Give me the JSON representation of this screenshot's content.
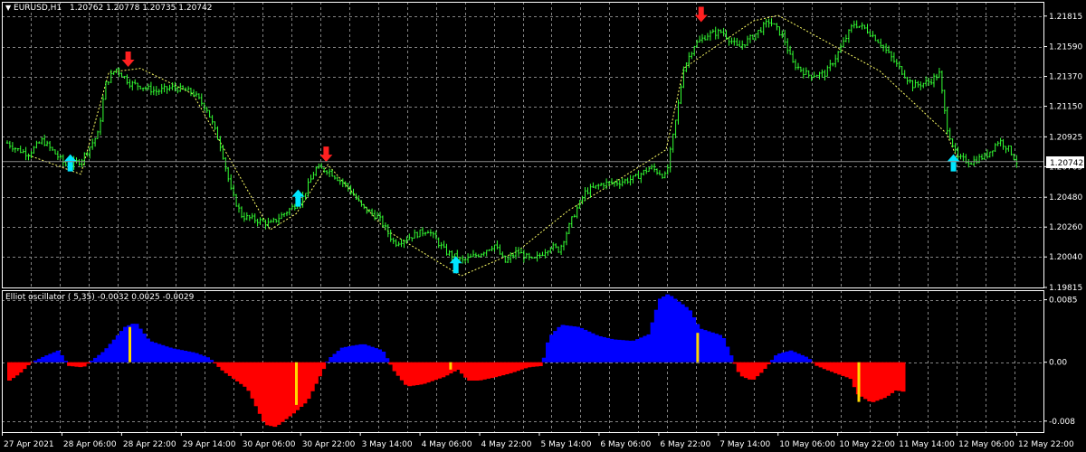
{
  "main_panel": {
    "symbol": "EURUSD,H1",
    "ohlc": "1.20762 1.20778 1.20735 1.20742",
    "dropdown_icon": "triangle-down-icon"
  },
  "oscillator_panel": {
    "title": "Elliot oscillator ( 5,35) -0.0032 0.0025 -0.0029"
  },
  "colors": {
    "background": "#000000",
    "grid": "#9a9a9a",
    "candles": "#33ff33",
    "zigzag": "#ffff66",
    "buy_arrow": "#00e5ff",
    "sell_arrow": "#ff2020",
    "osc_positive": "#0000ff",
    "osc_negative": "#ff0000",
    "osc_signal": "#ffd700"
  },
  "chart_data": [
    {
      "type": "line",
      "name": "EURUSD,H1 price",
      "ylim": [
        1.19815,
        1.2192
      ],
      "y_ticks": [
        "1.21815",
        "1.21590",
        "1.21370",
        "1.21150",
        "1.20925",
        "1.20705",
        "1.20480",
        "1.20260",
        "1.20040",
        "1.19815"
      ],
      "current_price_label": "1.20742",
      "current_price": 1.20742,
      "x_labels": [
        "27 Apr 2021",
        "28 Apr 06:00",
        "28 Apr 22:00",
        "29 Apr 14:00",
        "30 Apr 06:00",
        "30 Apr 22:00",
        "3 May 14:00",
        "4 May 06:00",
        "4 May 22:00",
        "5 May 14:00",
        "6 May 06:00",
        "6 May 22:00",
        "7 May 14:00",
        "10 May 06:00",
        "10 May 22:00",
        "11 May 14:00",
        "12 May 06:00",
        "12 May 22:00"
      ],
      "grid": true,
      "price_path": [
        [
          0.0,
          1.2088
        ],
        [
          0.6,
          1.2083
        ],
        [
          1.2,
          1.208
        ],
        [
          2.0,
          1.209
        ],
        [
          2.6,
          1.2082
        ],
        [
          3.4,
          1.2071
        ],
        [
          4.2,
          1.2075
        ],
        [
          5.2,
          1.2095
        ],
        [
          5.6,
          1.2131
        ],
        [
          6.2,
          1.2143
        ],
        [
          7.0,
          1.2132
        ],
        [
          7.6,
          1.213
        ],
        [
          8.5,
          1.2126
        ],
        [
          9.5,
          1.2129
        ],
        [
          10.6,
          1.2125
        ],
        [
          11.4,
          1.2113
        ],
        [
          12.2,
          1.2085
        ],
        [
          12.8,
          1.2051
        ],
        [
          13.4,
          1.2034
        ],
        [
          14.3,
          1.2031
        ],
        [
          15.0,
          1.2028
        ],
        [
          15.8,
          1.2036
        ],
        [
          16.8,
          1.2046
        ],
        [
          17.6,
          1.2069
        ],
        [
          18.3,
          1.2068
        ],
        [
          19.4,
          1.2056
        ],
        [
          20.3,
          1.204
        ],
        [
          21.2,
          1.2033
        ],
        [
          22.1,
          1.2014
        ],
        [
          23.0,
          1.2019
        ],
        [
          24.0,
          1.2024
        ],
        [
          25.0,
          1.2008
        ],
        [
          26.0,
          1.2001
        ],
        [
          26.9,
          1.2006
        ],
        [
          27.8,
          1.2013
        ],
        [
          28.4,
          1.2
        ],
        [
          29.1,
          1.2008
        ],
        [
          30.0,
          1.2001
        ],
        [
          31.0,
          1.2012
        ],
        [
          31.5,
          1.2009
        ],
        [
          32.3,
          1.2034
        ],
        [
          33.0,
          1.2052
        ],
        [
          34.0,
          1.2058
        ],
        [
          34.9,
          1.2059
        ],
        [
          35.8,
          1.2062
        ],
        [
          36.7,
          1.207
        ],
        [
          37.6,
          1.2063
        ],
        [
          38.2,
          1.2108
        ],
        [
          38.6,
          1.2143
        ],
        [
          39.2,
          1.216
        ],
        [
          40.0,
          1.2168
        ],
        [
          40.8,
          1.217
        ],
        [
          41.7,
          1.2158
        ],
        [
          42.6,
          1.2167
        ],
        [
          43.5,
          1.2178
        ],
        [
          44.3,
          1.2166
        ],
        [
          44.8,
          1.2147
        ],
        [
          45.7,
          1.2138
        ],
        [
          46.7,
          1.2139
        ],
        [
          47.4,
          1.2154
        ],
        [
          48.3,
          1.2176
        ],
        [
          49.0,
          1.2172
        ],
        [
          49.8,
          1.2162
        ],
        [
          50.8,
          1.2145
        ],
        [
          51.7,
          1.213
        ],
        [
          52.6,
          1.2133
        ],
        [
          53.2,
          1.2139
        ],
        [
          53.6,
          1.2101
        ],
        [
          54.2,
          1.2077
        ],
        [
          55.0,
          1.2074
        ],
        [
          55.9,
          1.2079
        ],
        [
          56.6,
          1.209
        ],
        [
          57.2,
          1.2083
        ],
        [
          57.6,
          1.2074
        ]
      ],
      "zigzag": [
        [
          1.2,
          1.2079
        ],
        [
          4.2,
          1.2065
        ],
        [
          5.8,
          1.214
        ],
        [
          7.6,
          1.2143
        ],
        [
          10.6,
          1.2124
        ],
        [
          15.0,
          1.2024
        ],
        [
          16.5,
          1.2036
        ],
        [
          18.3,
          1.2072
        ],
        [
          21.6,
          1.2024
        ],
        [
          25.9,
          1.199
        ],
        [
          29.1,
          1.2008
        ],
        [
          32.0,
          1.2038
        ],
        [
          34.9,
          1.2061
        ],
        [
          37.6,
          1.2083
        ],
        [
          38.6,
          1.2143
        ],
        [
          42.6,
          1.2178
        ],
        [
          44.0,
          1.2182
        ],
        [
          49.8,
          1.2141
        ],
        [
          53.6,
          1.2095
        ],
        [
          54.3,
          1.2074
        ]
      ],
      "buy_arrows": [
        [
          3.6,
          1.2073
        ],
        [
          16.6,
          1.2047
        ],
        [
          25.6,
          1.1998
        ],
        [
          54.0,
          1.2073
        ]
      ],
      "sell_arrows": [
        [
          6.9,
          1.215
        ],
        [
          18.2,
          1.208
        ],
        [
          39.6,
          1.2183
        ]
      ]
    },
    {
      "type": "bar",
      "name": "Elliot oscillator ( 5,35)",
      "ylim": [
        -0.0095,
        0.0098
      ],
      "y_ticks": [
        "0.0085",
        "0.00",
        "-0.008"
      ],
      "current_values": [
        -0.0032,
        0.0025,
        -0.0029
      ],
      "grid": true,
      "hist_path": [
        [
          0.0,
          -0.0025
        ],
        [
          0.6,
          -0.0015
        ],
        [
          1.2,
          -0.0001
        ],
        [
          2.0,
          0.0008
        ],
        [
          2.8,
          0.0016
        ],
        [
          3.4,
          -0.0005
        ],
        [
          4.2,
          -0.0007
        ],
        [
          5.4,
          0.0015
        ],
        [
          6.6,
          0.0048
        ],
        [
          7.2,
          0.0054
        ],
        [
          8.0,
          0.0029
        ],
        [
          9.3,
          0.0019
        ],
        [
          10.6,
          0.0013
        ],
        [
          11.4,
          0.0006
        ],
        [
          12.2,
          -0.0012
        ],
        [
          13.6,
          -0.0036
        ],
        [
          14.6,
          -0.0085
        ],
        [
          15.2,
          -0.0088
        ],
        [
          16.2,
          -0.007
        ],
        [
          17.0,
          -0.0053
        ],
        [
          18.2,
          0.0004
        ],
        [
          19.0,
          0.002
        ],
        [
          20.2,
          0.0025
        ],
        [
          21.3,
          0.0016
        ],
        [
          22.0,
          -0.0013
        ],
        [
          22.7,
          -0.0033
        ],
        [
          23.6,
          -0.003
        ],
        [
          24.8,
          -0.002
        ],
        [
          25.6,
          -0.001
        ],
        [
          26.2,
          -0.0025
        ],
        [
          26.8,
          -0.0025
        ],
        [
          27.8,
          -0.002
        ],
        [
          28.6,
          -0.0015
        ],
        [
          29.6,
          -0.0007
        ],
        [
          30.4,
          -0.0005
        ],
        [
          30.8,
          0.0034
        ],
        [
          31.5,
          0.0051
        ],
        [
          32.5,
          0.0048
        ],
        [
          33.6,
          0.0036
        ],
        [
          34.5,
          0.0031
        ],
        [
          35.6,
          0.0029
        ],
        [
          36.5,
          0.0038
        ],
        [
          37.1,
          0.0086
        ],
        [
          37.6,
          0.0093
        ],
        [
          38.8,
          0.0072
        ],
        [
          39.4,
          0.0046
        ],
        [
          40.7,
          0.0036
        ],
        [
          41.3,
          0.0003
        ],
        [
          41.7,
          -0.0018
        ],
        [
          42.4,
          -0.0025
        ],
        [
          43.0,
          -0.0012
        ],
        [
          43.8,
          0.0011
        ],
        [
          44.6,
          0.0016
        ],
        [
          45.6,
          0.0006
        ],
        [
          46.0,
          -0.0004
        ],
        [
          46.6,
          -0.001
        ],
        [
          47.5,
          -0.0018
        ],
        [
          48.0,
          -0.0022
        ],
        [
          48.4,
          -0.0043
        ],
        [
          49.2,
          -0.0055
        ],
        [
          50.0,
          -0.0048
        ],
        [
          50.6,
          -0.0038
        ],
        [
          51.0,
          -0.004
        ]
      ],
      "signal_bars": [
        [
          7.0,
          0.0048
        ],
        [
          16.5,
          -0.0058
        ],
        [
          25.3,
          -0.001
        ],
        [
          39.4,
          0.004
        ],
        [
          48.6,
          -0.0054
        ]
      ]
    }
  ]
}
